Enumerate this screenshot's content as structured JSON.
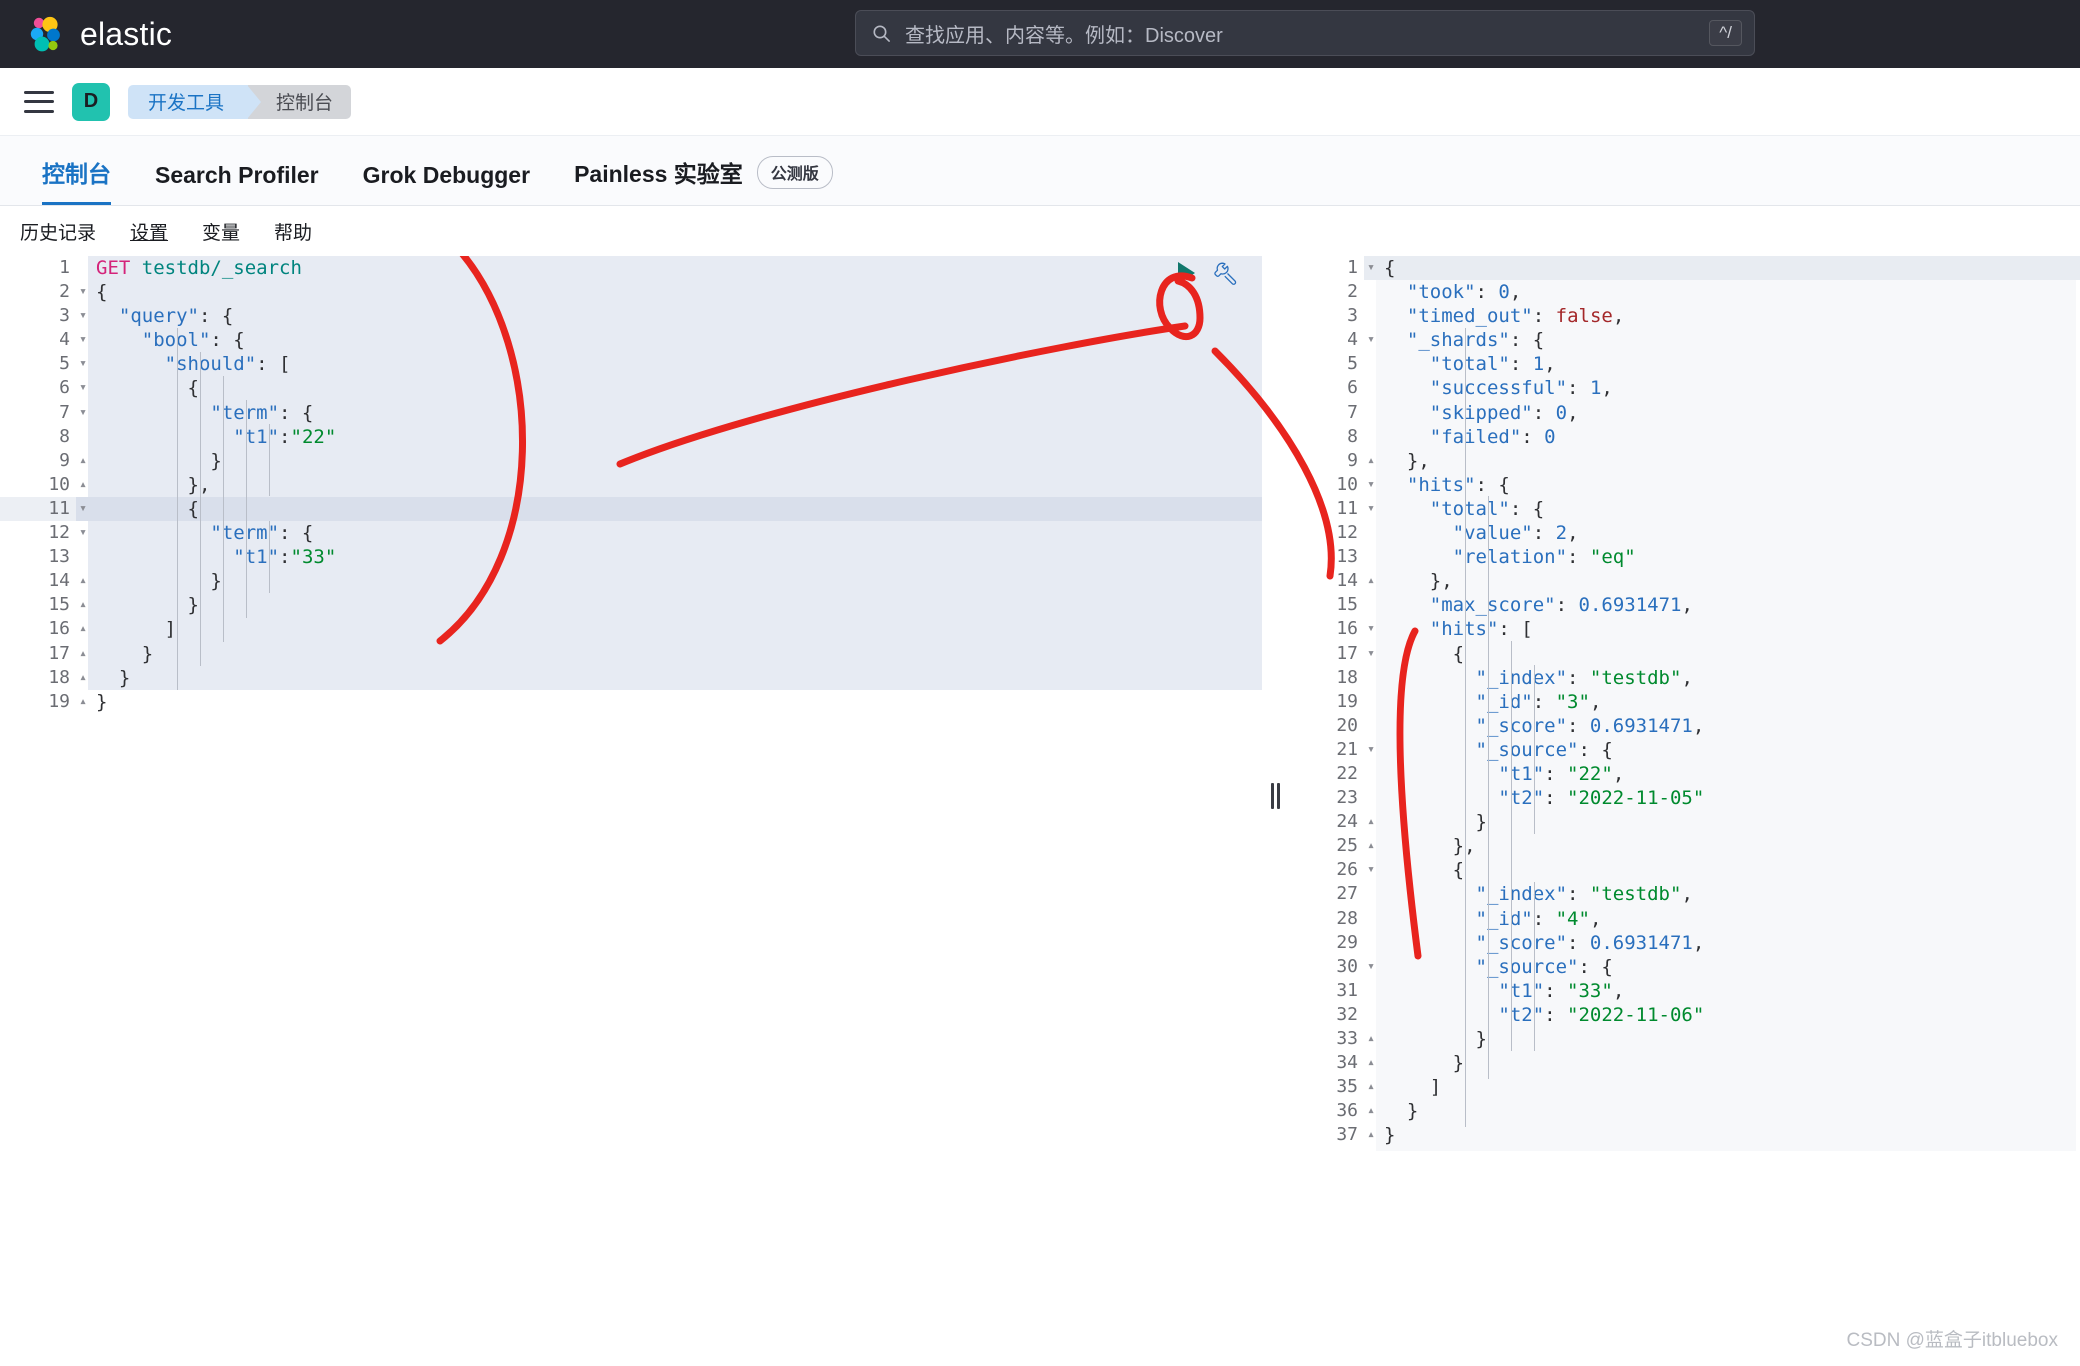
{
  "header": {
    "brand_name": "elastic",
    "logo_icon": "elastic-logo-icon",
    "search": {
      "icon": "search-icon",
      "placeholder": "查找应用、内容等。例如：Discover",
      "value": "",
      "shortcut": "^/"
    }
  },
  "breadcrumb": {
    "menu_icon": "hamburger-menu-icon",
    "space_avatar_letter": "D",
    "items": [
      {
        "label": "开发工具"
      },
      {
        "label": "控制台"
      }
    ]
  },
  "tabs": [
    {
      "label": "控制台",
      "active": true,
      "badge": null
    },
    {
      "label": "Search Profiler",
      "active": false,
      "badge": null
    },
    {
      "label": "Grok Debugger",
      "active": false,
      "badge": null
    },
    {
      "label": "Painless 实验室",
      "active": false,
      "badge": "公测版"
    }
  ],
  "subtoolbar": [
    {
      "label": "历史记录",
      "underlined": false
    },
    {
      "label": "设置",
      "underlined": true
    },
    {
      "label": "变量",
      "underlined": false
    },
    {
      "label": "帮助",
      "underlined": false
    }
  ],
  "editor_actions": {
    "play_icon": "play-triangle-icon",
    "wrench_icon": "wrench-icon"
  },
  "request_editor": {
    "name": "console-request-editor",
    "active_line": 11,
    "lines": [
      {
        "n": 1,
        "fold": "",
        "tokens": [
          {
            "t": "method",
            "s": "GET"
          },
          {
            "t": "plain",
            "s": " "
          },
          {
            "t": "url",
            "s": "testdb/_search"
          }
        ]
      },
      {
        "n": 2,
        "fold": "▾",
        "tokens": [
          {
            "t": "punc",
            "s": "{"
          }
        ]
      },
      {
        "n": 3,
        "fold": "▾",
        "tokens": [
          {
            "t": "plain",
            "s": "  "
          },
          {
            "t": "key",
            "s": "\"query\""
          },
          {
            "t": "punc",
            "s": ": {"
          }
        ]
      },
      {
        "n": 4,
        "fold": "▾",
        "tokens": [
          {
            "t": "plain",
            "s": "    "
          },
          {
            "t": "key",
            "s": "\"bool\""
          },
          {
            "t": "punc",
            "s": ": {"
          }
        ]
      },
      {
        "n": 5,
        "fold": "▾",
        "tokens": [
          {
            "t": "plain",
            "s": "      "
          },
          {
            "t": "key",
            "s": "\"should\""
          },
          {
            "t": "punc",
            "s": ": ["
          }
        ]
      },
      {
        "n": 6,
        "fold": "▾",
        "tokens": [
          {
            "t": "plain",
            "s": "        "
          },
          {
            "t": "punc",
            "s": "{"
          }
        ]
      },
      {
        "n": 7,
        "fold": "▾",
        "tokens": [
          {
            "t": "plain",
            "s": "          "
          },
          {
            "t": "key",
            "s": "\"term\""
          },
          {
            "t": "punc",
            "s": ": {"
          }
        ]
      },
      {
        "n": 8,
        "fold": "",
        "tokens": [
          {
            "t": "plain",
            "s": "            "
          },
          {
            "t": "key",
            "s": "\"t1\""
          },
          {
            "t": "punc",
            "s": ":"
          },
          {
            "t": "str",
            "s": "\"22\""
          }
        ]
      },
      {
        "n": 9,
        "fold": "▴",
        "tokens": [
          {
            "t": "plain",
            "s": "          "
          },
          {
            "t": "punc",
            "s": "}"
          }
        ]
      },
      {
        "n": 10,
        "fold": "▴",
        "tokens": [
          {
            "t": "plain",
            "s": "        "
          },
          {
            "t": "punc",
            "s": "},"
          }
        ]
      },
      {
        "n": 11,
        "fold": "▾",
        "tokens": [
          {
            "t": "plain",
            "s": "        "
          },
          {
            "t": "punc",
            "s": "{"
          }
        ]
      },
      {
        "n": 12,
        "fold": "▾",
        "tokens": [
          {
            "t": "plain",
            "s": "          "
          },
          {
            "t": "key",
            "s": "\"term\""
          },
          {
            "t": "punc",
            "s": ": {"
          }
        ]
      },
      {
        "n": 13,
        "fold": "",
        "tokens": [
          {
            "t": "plain",
            "s": "            "
          },
          {
            "t": "key",
            "s": "\"t1\""
          },
          {
            "t": "punc",
            "s": ":"
          },
          {
            "t": "str",
            "s": "\"33\""
          }
        ]
      },
      {
        "n": 14,
        "fold": "▴",
        "tokens": [
          {
            "t": "plain",
            "s": "          "
          },
          {
            "t": "punc",
            "s": "}"
          }
        ]
      },
      {
        "n": 15,
        "fold": "▴",
        "tokens": [
          {
            "t": "plain",
            "s": "        "
          },
          {
            "t": "punc",
            "s": "}"
          }
        ]
      },
      {
        "n": 16,
        "fold": "▴",
        "tokens": [
          {
            "t": "plain",
            "s": "      "
          },
          {
            "t": "punc",
            "s": "]"
          }
        ]
      },
      {
        "n": 17,
        "fold": "▴",
        "tokens": [
          {
            "t": "plain",
            "s": "    "
          },
          {
            "t": "punc",
            "s": "}"
          }
        ]
      },
      {
        "n": 18,
        "fold": "▴",
        "tokens": [
          {
            "t": "plain",
            "s": "  "
          },
          {
            "t": "punc",
            "s": "}"
          }
        ]
      },
      {
        "n": 19,
        "fold": "▴",
        "tokens": [
          {
            "t": "punc",
            "s": "}"
          }
        ]
      }
    ]
  },
  "response_editor": {
    "name": "console-response-editor",
    "active_line": 1,
    "lines": [
      {
        "n": 1,
        "fold": "▾",
        "tokens": [
          {
            "t": "punc",
            "s": "{"
          }
        ]
      },
      {
        "n": 2,
        "fold": "",
        "tokens": [
          {
            "t": "plain",
            "s": "  "
          },
          {
            "t": "key",
            "s": "\"took\""
          },
          {
            "t": "punc",
            "s": ": "
          },
          {
            "t": "num",
            "s": "0"
          },
          {
            "t": "punc",
            "s": ","
          }
        ]
      },
      {
        "n": 3,
        "fold": "",
        "tokens": [
          {
            "t": "plain",
            "s": "  "
          },
          {
            "t": "key",
            "s": "\"timed_out\""
          },
          {
            "t": "punc",
            "s": ": "
          },
          {
            "t": "bool",
            "s": "false"
          },
          {
            "t": "punc",
            "s": ","
          }
        ]
      },
      {
        "n": 4,
        "fold": "▾",
        "tokens": [
          {
            "t": "plain",
            "s": "  "
          },
          {
            "t": "key",
            "s": "\"_shards\""
          },
          {
            "t": "punc",
            "s": ": {"
          }
        ]
      },
      {
        "n": 5,
        "fold": "",
        "tokens": [
          {
            "t": "plain",
            "s": "    "
          },
          {
            "t": "key",
            "s": "\"total\""
          },
          {
            "t": "punc",
            "s": ": "
          },
          {
            "t": "num",
            "s": "1"
          },
          {
            "t": "punc",
            "s": ","
          }
        ]
      },
      {
        "n": 6,
        "fold": "",
        "tokens": [
          {
            "t": "plain",
            "s": "    "
          },
          {
            "t": "key",
            "s": "\"successful\""
          },
          {
            "t": "punc",
            "s": ": "
          },
          {
            "t": "num",
            "s": "1"
          },
          {
            "t": "punc",
            "s": ","
          }
        ]
      },
      {
        "n": 7,
        "fold": "",
        "tokens": [
          {
            "t": "plain",
            "s": "    "
          },
          {
            "t": "key",
            "s": "\"skipped\""
          },
          {
            "t": "punc",
            "s": ": "
          },
          {
            "t": "num",
            "s": "0"
          },
          {
            "t": "punc",
            "s": ","
          }
        ]
      },
      {
        "n": 8,
        "fold": "",
        "tokens": [
          {
            "t": "plain",
            "s": "    "
          },
          {
            "t": "key",
            "s": "\"failed\""
          },
          {
            "t": "punc",
            "s": ": "
          },
          {
            "t": "num",
            "s": "0"
          }
        ]
      },
      {
        "n": 9,
        "fold": "▴",
        "tokens": [
          {
            "t": "plain",
            "s": "  "
          },
          {
            "t": "punc",
            "s": "},"
          }
        ]
      },
      {
        "n": 10,
        "fold": "▾",
        "tokens": [
          {
            "t": "plain",
            "s": "  "
          },
          {
            "t": "key",
            "s": "\"hits\""
          },
          {
            "t": "punc",
            "s": ": {"
          }
        ]
      },
      {
        "n": 11,
        "fold": "▾",
        "tokens": [
          {
            "t": "plain",
            "s": "    "
          },
          {
            "t": "key",
            "s": "\"total\""
          },
          {
            "t": "punc",
            "s": ": {"
          }
        ]
      },
      {
        "n": 12,
        "fold": "",
        "tokens": [
          {
            "t": "plain",
            "s": "      "
          },
          {
            "t": "key",
            "s": "\"value\""
          },
          {
            "t": "punc",
            "s": ": "
          },
          {
            "t": "num",
            "s": "2"
          },
          {
            "t": "punc",
            "s": ","
          }
        ]
      },
      {
        "n": 13,
        "fold": "",
        "tokens": [
          {
            "t": "plain",
            "s": "      "
          },
          {
            "t": "key",
            "s": "\"relation\""
          },
          {
            "t": "punc",
            "s": ": "
          },
          {
            "t": "str",
            "s": "\"eq\""
          }
        ]
      },
      {
        "n": 14,
        "fold": "▴",
        "tokens": [
          {
            "t": "plain",
            "s": "    "
          },
          {
            "t": "punc",
            "s": "},"
          }
        ]
      },
      {
        "n": 15,
        "fold": "",
        "tokens": [
          {
            "t": "plain",
            "s": "    "
          },
          {
            "t": "key",
            "s": "\"max_score\""
          },
          {
            "t": "punc",
            "s": ": "
          },
          {
            "t": "num",
            "s": "0.6931471"
          },
          {
            "t": "punc",
            "s": ","
          }
        ]
      },
      {
        "n": 16,
        "fold": "▾",
        "tokens": [
          {
            "t": "plain",
            "s": "    "
          },
          {
            "t": "key",
            "s": "\"hits\""
          },
          {
            "t": "punc",
            "s": ": ["
          }
        ]
      },
      {
        "n": 17,
        "fold": "▾",
        "tokens": [
          {
            "t": "plain",
            "s": "      "
          },
          {
            "t": "punc",
            "s": "{"
          }
        ]
      },
      {
        "n": 18,
        "fold": "",
        "tokens": [
          {
            "t": "plain",
            "s": "        "
          },
          {
            "t": "key",
            "s": "\"_index\""
          },
          {
            "t": "punc",
            "s": ": "
          },
          {
            "t": "str",
            "s": "\"testdb\""
          },
          {
            "t": "punc",
            "s": ","
          }
        ]
      },
      {
        "n": 19,
        "fold": "",
        "tokens": [
          {
            "t": "plain",
            "s": "        "
          },
          {
            "t": "key",
            "s": "\"_id\""
          },
          {
            "t": "punc",
            "s": ": "
          },
          {
            "t": "str",
            "s": "\"3\""
          },
          {
            "t": "punc",
            "s": ","
          }
        ]
      },
      {
        "n": 20,
        "fold": "",
        "tokens": [
          {
            "t": "plain",
            "s": "        "
          },
          {
            "t": "key",
            "s": "\"_score\""
          },
          {
            "t": "punc",
            "s": ": "
          },
          {
            "t": "num",
            "s": "0.6931471"
          },
          {
            "t": "punc",
            "s": ","
          }
        ]
      },
      {
        "n": 21,
        "fold": "▾",
        "tokens": [
          {
            "t": "plain",
            "s": "        "
          },
          {
            "t": "key",
            "s": "\"_source\""
          },
          {
            "t": "punc",
            "s": ": {"
          }
        ]
      },
      {
        "n": 22,
        "fold": "",
        "tokens": [
          {
            "t": "plain",
            "s": "          "
          },
          {
            "t": "key",
            "s": "\"t1\""
          },
          {
            "t": "punc",
            "s": ": "
          },
          {
            "t": "str",
            "s": "\"22\""
          },
          {
            "t": "punc",
            "s": ","
          }
        ]
      },
      {
        "n": 23,
        "fold": "",
        "tokens": [
          {
            "t": "plain",
            "s": "          "
          },
          {
            "t": "key",
            "s": "\"t2\""
          },
          {
            "t": "punc",
            "s": ": "
          },
          {
            "t": "str",
            "s": "\"2022-11-05\""
          }
        ]
      },
      {
        "n": 24,
        "fold": "▴",
        "tokens": [
          {
            "t": "plain",
            "s": "        "
          },
          {
            "t": "punc",
            "s": "}"
          }
        ]
      },
      {
        "n": 25,
        "fold": "▴",
        "tokens": [
          {
            "t": "plain",
            "s": "      "
          },
          {
            "t": "punc",
            "s": "},"
          }
        ]
      },
      {
        "n": 26,
        "fold": "▾",
        "tokens": [
          {
            "t": "plain",
            "s": "      "
          },
          {
            "t": "punc",
            "s": "{"
          }
        ]
      },
      {
        "n": 27,
        "fold": "",
        "tokens": [
          {
            "t": "plain",
            "s": "        "
          },
          {
            "t": "key",
            "s": "\"_index\""
          },
          {
            "t": "punc",
            "s": ": "
          },
          {
            "t": "str",
            "s": "\"testdb\""
          },
          {
            "t": "punc",
            "s": ","
          }
        ]
      },
      {
        "n": 28,
        "fold": "",
        "tokens": [
          {
            "t": "plain",
            "s": "        "
          },
          {
            "t": "key",
            "s": "\"_id\""
          },
          {
            "t": "punc",
            "s": ": "
          },
          {
            "t": "str",
            "s": "\"4\""
          },
          {
            "t": "punc",
            "s": ","
          }
        ]
      },
      {
        "n": 29,
        "fold": "",
        "tokens": [
          {
            "t": "plain",
            "s": "        "
          },
          {
            "t": "key",
            "s": "\"_score\""
          },
          {
            "t": "punc",
            "s": ": "
          },
          {
            "t": "num",
            "s": "0.6931471"
          },
          {
            "t": "punc",
            "s": ","
          }
        ]
      },
      {
        "n": 30,
        "fold": "▾",
        "tokens": [
          {
            "t": "plain",
            "s": "        "
          },
          {
            "t": "key",
            "s": "\"_source\""
          },
          {
            "t": "punc",
            "s": ": {"
          }
        ]
      },
      {
        "n": 31,
        "fold": "",
        "tokens": [
          {
            "t": "plain",
            "s": "          "
          },
          {
            "t": "key",
            "s": "\"t1\""
          },
          {
            "t": "punc",
            "s": ": "
          },
          {
            "t": "str",
            "s": "\"33\""
          },
          {
            "t": "punc",
            "s": ","
          }
        ]
      },
      {
        "n": 32,
        "fold": "",
        "tokens": [
          {
            "t": "plain",
            "s": "          "
          },
          {
            "t": "key",
            "s": "\"t2\""
          },
          {
            "t": "punc",
            "s": ": "
          },
          {
            "t": "str",
            "s": "\"2022-11-06\""
          }
        ]
      },
      {
        "n": 33,
        "fold": "▴",
        "tokens": [
          {
            "t": "plain",
            "s": "        "
          },
          {
            "t": "punc",
            "s": "}"
          }
        ]
      },
      {
        "n": 34,
        "fold": "▴",
        "tokens": [
          {
            "t": "plain",
            "s": "      "
          },
          {
            "t": "punc",
            "s": "}"
          }
        ]
      },
      {
        "n": 35,
        "fold": "▴",
        "tokens": [
          {
            "t": "plain",
            "s": "    "
          },
          {
            "t": "punc",
            "s": "]"
          }
        ]
      },
      {
        "n": 36,
        "fold": "▴",
        "tokens": [
          {
            "t": "plain",
            "s": "  "
          },
          {
            "t": "punc",
            "s": "}"
          }
        ]
      },
      {
        "n": 37,
        "fold": "▴",
        "tokens": [
          {
            "t": "punc",
            "s": "}"
          }
        ]
      }
    ]
  },
  "divider": {
    "name": "pane-resize-handle"
  },
  "annotations": {
    "color": "#e8241e",
    "description": "hand-drawn red arc markings"
  },
  "watermark": "CSDN @蓝盒子itbluebox"
}
